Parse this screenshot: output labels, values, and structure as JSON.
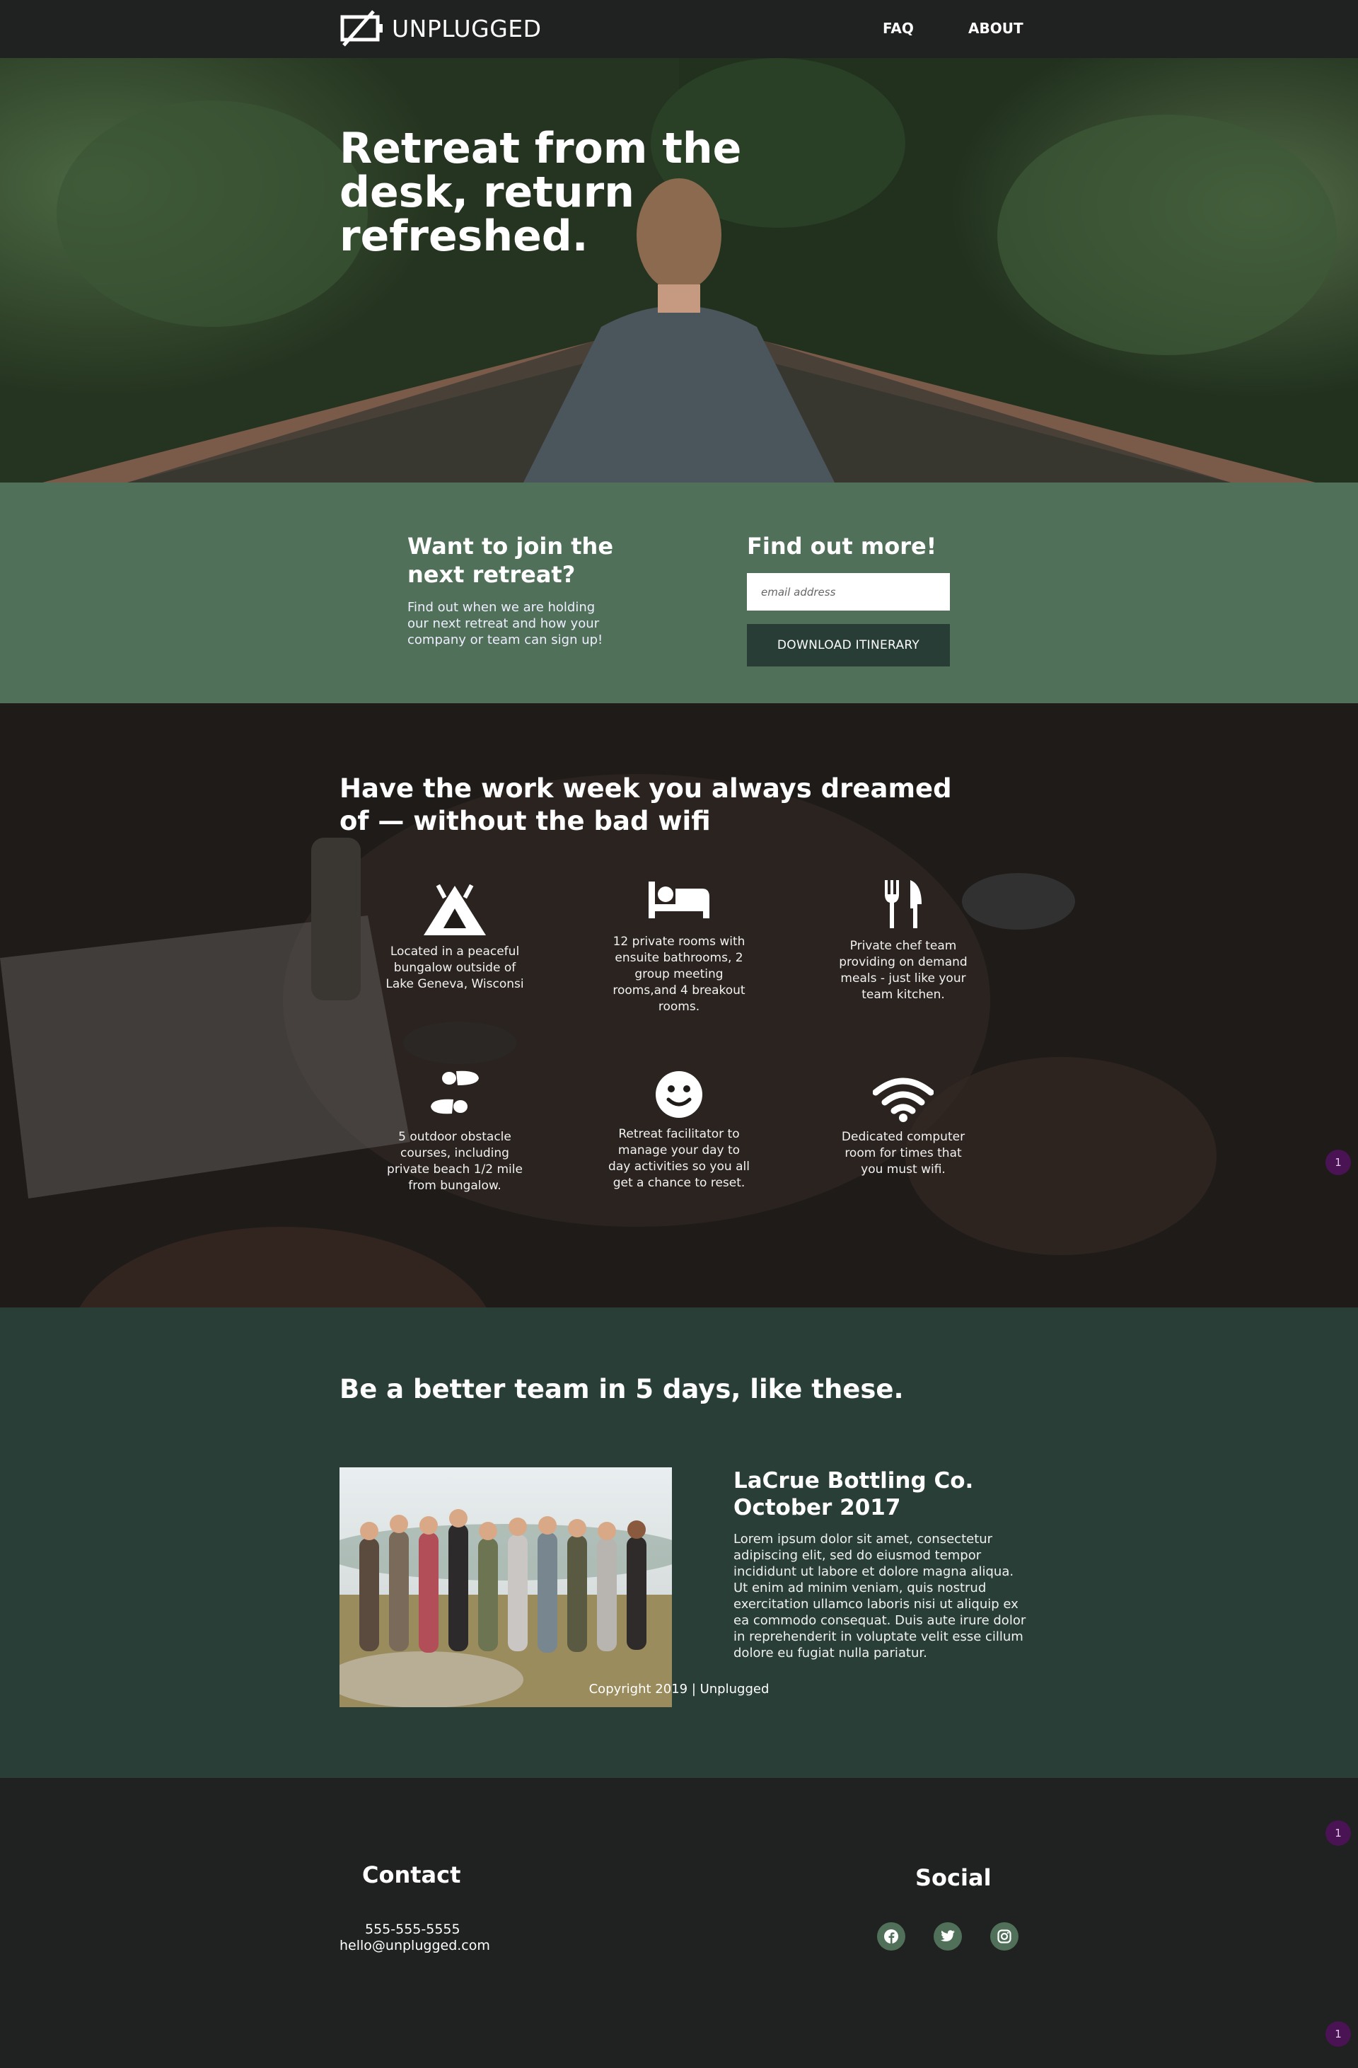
{
  "nav": {
    "logo_text": "UNPLUGGED",
    "links": [
      {
        "label": "FAQ"
      },
      {
        "label": "ABOUT"
      }
    ]
  },
  "hero": {
    "title": "Retreat from the desk, return refreshed."
  },
  "signup": {
    "heading": "Want to join the next retreat?",
    "text": "Find out when we are holding our next retreat and how your company or team can sign up!",
    "form_heading": "Find out more!",
    "email_placeholder": "email address",
    "button_label": "DOWNLOAD ITINERARY"
  },
  "features": {
    "heading": "Have the work week you always dreamed of — without the bad wifi",
    "items": [
      {
        "icon": "tent-icon",
        "text": "Located in a peaceful bungalow outside of Lake Geneva, Wisconsi"
      },
      {
        "icon": "bed-icon",
        "text": "12 private rooms with ensuite bathrooms, 2 group meeting rooms,and 4 breakout rooms."
      },
      {
        "icon": "utensils-icon",
        "text": "Private chef team providing on demand meals - just like your team kitchen."
      },
      {
        "icon": "shoe-prints-icon",
        "text": "5 outdoor obstacle courses, including private beach 1/2 mile from bungalow."
      },
      {
        "icon": "smile-icon",
        "text": "Retreat facilitator to manage your day to day activities so you all get a chance to reset."
      },
      {
        "icon": "wifi-icon",
        "text": "Dedicated computer room for times that you must wifi."
      }
    ]
  },
  "badges": [
    "1",
    "1",
    "1"
  ],
  "team": {
    "heading": "Be a better team in 5 days, like these.",
    "case_title": "LaCrue Bottling Co. October 2017",
    "case_text": "Lorem ipsum dolor sit amet, consectetur adipiscing elit, sed do eiusmod tempor incididunt ut labore et dolore magna aliqua. Ut enim ad minim veniam, quis nostrud exercitation ullamco laboris nisi ut aliquip ex ea commodo consequat. Duis aute irure dolor in reprehenderit in voluptate velit esse cillum dolore eu fugiat nulla pariatur."
  },
  "footer": {
    "contact_heading": "Contact",
    "phone": "555-555-5555",
    "email": "hello@unplugged.com",
    "social_heading": "Social",
    "social_icons": [
      "facebook-icon",
      "twitter-icon",
      "instagram-icon"
    ],
    "copyright": "Copyright 2019 | Unplugged"
  },
  "colors": {
    "nav_bg": "#202121",
    "signup_bg": "#51705a",
    "button_bg": "#283d35",
    "team_bg": "#283e36",
    "badge_bg": "#4a1354"
  }
}
